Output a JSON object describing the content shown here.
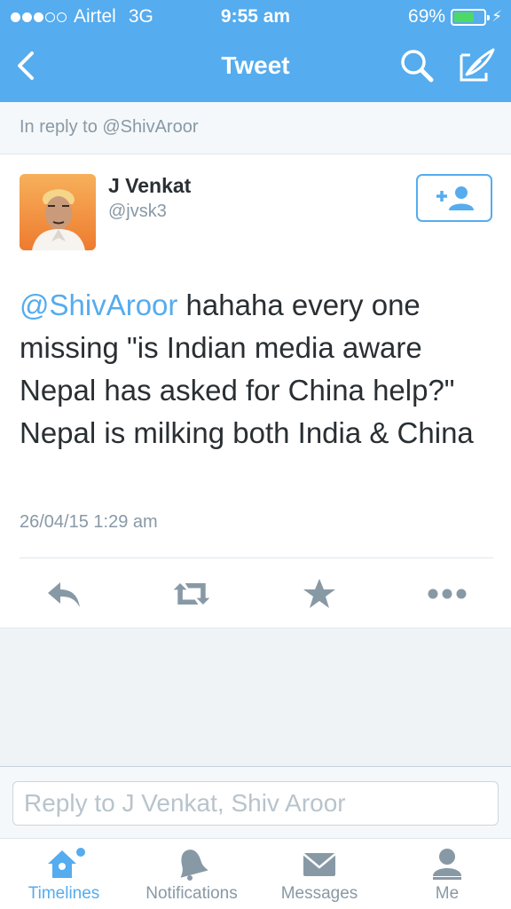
{
  "status_bar": {
    "carrier": "Airtel",
    "network": "3G",
    "time": "9:55 am",
    "battery_text": "69%",
    "battery_level": 0.69,
    "signal_bars": 3,
    "signal_total": 5
  },
  "nav": {
    "title": "Tweet",
    "back_icon": "chevron-left-icon",
    "search_icon": "search-icon",
    "compose_icon": "compose-icon"
  },
  "in_reply": {
    "text": "In reply to @ShivAroor"
  },
  "tweet": {
    "user_name": "J Venkat",
    "user_handle": "@jvsk3",
    "mention": "@ShivAroor",
    "body": " hahaha every one missing \"is Indian media aware Nepal has asked for China help?\" Nepal is milking both India & China",
    "timestamp": "26/04/15 1:29 am"
  },
  "actions": {
    "reply_icon": "reply-icon",
    "retweet_icon": "retweet-icon",
    "favorite_icon": "star-icon",
    "more_icon": "more-icon"
  },
  "reply_box": {
    "placeholder": "Reply to J Venkat, Shiv Aroor",
    "value": ""
  },
  "tab_bar": {
    "tabs": [
      {
        "label": "Timelines",
        "icon": "home-icon",
        "active": true
      },
      {
        "label": "Notifications",
        "icon": "bell-icon",
        "active": false
      },
      {
        "label": "Messages",
        "icon": "envelope-icon",
        "active": false
      },
      {
        "label": "Me",
        "icon": "person-icon",
        "active": false
      }
    ]
  },
  "colors": {
    "brand": "#55acee",
    "battery": "#4cd964",
    "text": "#292f33",
    "muted": "#8899a6"
  }
}
